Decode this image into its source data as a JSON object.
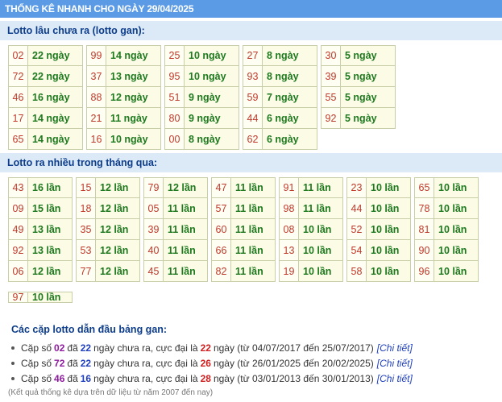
{
  "header": {
    "title": "THỐNG KÊ NHANH CHO NGÀY 29/04/2025"
  },
  "gan_section": {
    "title": "Lotto lâu chưa ra (lotto gan):",
    "columns": [
      [
        {
          "num": "02",
          "value": "22 ngày"
        },
        {
          "num": "72",
          "value": "22 ngày"
        },
        {
          "num": "46",
          "value": "16 ngày"
        },
        {
          "num": "17",
          "value": "14 ngày"
        },
        {
          "num": "65",
          "value": "14 ngày"
        }
      ],
      [
        {
          "num": "99",
          "value": "14 ngày"
        },
        {
          "num": "37",
          "value": "13 ngày"
        },
        {
          "num": "88",
          "value": "12 ngày"
        },
        {
          "num": "21",
          "value": "11 ngày"
        },
        {
          "num": "16",
          "value": "10 ngày"
        }
      ],
      [
        {
          "num": "25",
          "value": "10 ngày"
        },
        {
          "num": "95",
          "value": "10 ngày"
        },
        {
          "num": "51",
          "value": "9 ngày"
        },
        {
          "num": "80",
          "value": "9 ngày"
        },
        {
          "num": "00",
          "value": "8 ngày"
        }
      ],
      [
        {
          "num": "27",
          "value": "8 ngày"
        },
        {
          "num": "93",
          "value": "8 ngày"
        },
        {
          "num": "59",
          "value": "7 ngày"
        },
        {
          "num": "44",
          "value": "6 ngày"
        },
        {
          "num": "62",
          "value": "6 ngày"
        }
      ],
      [
        {
          "num": "30",
          "value": "5 ngày"
        },
        {
          "num": "39",
          "value": "5 ngày"
        },
        {
          "num": "55",
          "value": "5 ngày"
        },
        {
          "num": "92",
          "value": "5 ngày"
        }
      ]
    ]
  },
  "lotto_section": {
    "title": "Lotto ra nhiều trong tháng qua:",
    "columns": [
      [
        {
          "num": "43",
          "value": "16 lần"
        },
        {
          "num": "09",
          "value": "15 lần"
        },
        {
          "num": "49",
          "value": "13 lần"
        },
        {
          "num": "92",
          "value": "13 lần"
        },
        {
          "num": "06",
          "value": "12 lần"
        },
        {
          "num": "97",
          "value": "10 lần"
        }
      ],
      [
        {
          "num": "15",
          "value": "12 lần"
        },
        {
          "num": "18",
          "value": "12 lần"
        },
        {
          "num": "35",
          "value": "12 lần"
        },
        {
          "num": "53",
          "value": "12 lần"
        },
        {
          "num": "77",
          "value": "12 lần"
        }
      ],
      [
        {
          "num": "79",
          "value": "12 lần"
        },
        {
          "num": "05",
          "value": "11 lần"
        },
        {
          "num": "39",
          "value": "11 lần"
        },
        {
          "num": "40",
          "value": "11 lần"
        },
        {
          "num": "45",
          "value": "11 lần"
        }
      ],
      [
        {
          "num": "47",
          "value": "11 lần"
        },
        {
          "num": "57",
          "value": "11 lần"
        },
        {
          "num": "60",
          "value": "11 lần"
        },
        {
          "num": "66",
          "value": "11 lần"
        },
        {
          "num": "82",
          "value": "11 lần"
        }
      ],
      [
        {
          "num": "91",
          "value": "11 lần"
        },
        {
          "num": "98",
          "value": "11 lần"
        },
        {
          "num": "08",
          "value": "10 lần"
        },
        {
          "num": "13",
          "value": "10 lần"
        },
        {
          "num": "19",
          "value": "10 lần"
        }
      ],
      [
        {
          "num": "23",
          "value": "10 lần"
        },
        {
          "num": "44",
          "value": "10 lần"
        },
        {
          "num": "52",
          "value": "10 lần"
        },
        {
          "num": "54",
          "value": "10 lần"
        },
        {
          "num": "58",
          "value": "10 lần"
        }
      ],
      [
        {
          "num": "65",
          "value": "10 lần"
        },
        {
          "num": "78",
          "value": "10 lần"
        },
        {
          "num": "81",
          "value": "10 lần"
        },
        {
          "num": "90",
          "value": "10 lần"
        },
        {
          "num": "96",
          "value": "10 lần"
        }
      ]
    ]
  },
  "pairs_section": {
    "title": "Các cặp lotto dẫn đầu bảng gan:",
    "items": [
      {
        "prefix": "Cặp số",
        "pair": "02",
        "mid1": "đã",
        "days": "22",
        "mid2": "ngày chưa ra, cực đại là",
        "max": "22",
        "suffix": "ngày (từ 04/07/2017 đến 25/07/2017)",
        "link": "[Chi tiết]"
      },
      {
        "prefix": "Cặp số",
        "pair": "72",
        "mid1": "đã",
        "days": "22",
        "mid2": "ngày chưa ra, cực đại là",
        "max": "26",
        "suffix": "ngày (từ 26/01/2025 đến 20/02/2025)",
        "link": "[Chi tiết]"
      },
      {
        "prefix": "Cặp số",
        "pair": "46",
        "mid1": "đã",
        "days": "16",
        "mid2": "ngày chưa ra, cực đại là",
        "max": "28",
        "suffix": "ngày (từ 03/01/2013 đến 30/01/2013)",
        "link": "[Chi tiết]"
      }
    ]
  },
  "footnote": "(Kết quả thống kê dựa trên dữ liệu từ năm 2007 đến nay)",
  "colors": {
    "header_bg": "#5b9be6",
    "section_bg": "#dceaf8",
    "number_red": "#c0392b",
    "value_green": "#1f7a1f"
  }
}
